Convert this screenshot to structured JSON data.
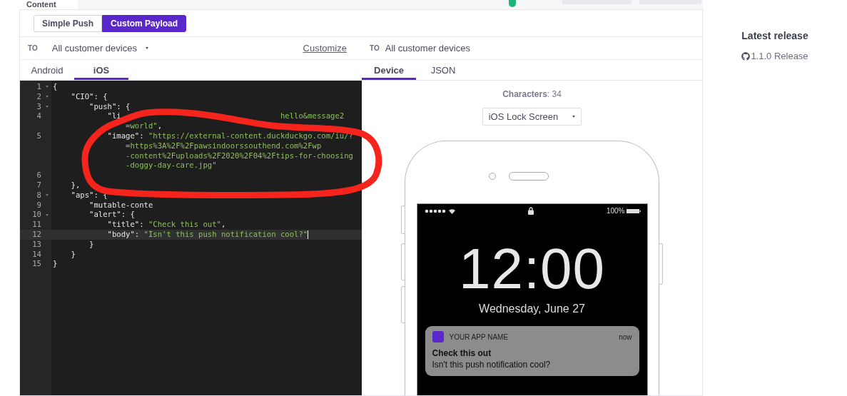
{
  "top_bar": {
    "tab": "Content"
  },
  "mode_switch": [
    {
      "label": "Simple Push",
      "selected": false
    },
    {
      "label": "Custom Payload",
      "selected": true
    }
  ],
  "left_recipients": {
    "label": "TO",
    "value": "All customer devices"
  },
  "customize_link": "Customize",
  "right_recipients": {
    "label": "TO",
    "value": "All customer devices"
  },
  "platform_tabs": [
    {
      "label": "Android",
      "selected": false
    },
    {
      "label": "iOS",
      "selected": true
    }
  ],
  "preview_tabs": [
    {
      "label": "Device",
      "selected": true
    },
    {
      "label": "JSON",
      "selected": false
    }
  ],
  "editor": {
    "rows": [
      {
        "number": "1",
        "fold": true,
        "highlighted": false,
        "parts": [
          {
            "kind": "punct",
            "text": "{"
          }
        ]
      },
      {
        "number": "2",
        "fold": true,
        "highlighted": false,
        "parts": [
          {
            "kind": "key",
            "text": "    \"CIO\": {"
          }
        ]
      },
      {
        "number": "3",
        "fold": true,
        "highlighted": false,
        "parts": [
          {
            "kind": "key",
            "text": "        \"push\": {"
          }
        ]
      },
      {
        "number": "4",
        "fold": false,
        "highlighted": false,
        "parts": [
          {
            "kind": "key",
            "text": "            \"li"
          },
          {
            "kind": "tail",
            "text": "hello&message2"
          }
        ]
      },
      {
        "fold": false,
        "highlighted": false,
        "parts": [
          {
            "kind": "string",
            "text": "                =world\""
          },
          {
            "kind": "punct",
            "text": ","
          }
        ]
      },
      {
        "number": "5",
        "fold": false,
        "highlighted": false,
        "parts": [
          {
            "kind": "key",
            "text": "            \"image\": "
          },
          {
            "kind": "string",
            "text": "\"https://external-content.duckduckgo.com/iu/?"
          }
        ]
      },
      {
        "fold": false,
        "highlighted": false,
        "parts": [
          {
            "kind": "string",
            "text": "                =https%3A%2F%2Fpawsindoorssouthend.com%2Fwp"
          }
        ]
      },
      {
        "fold": false,
        "highlighted": false,
        "parts": [
          {
            "kind": "string",
            "text": "                -content%2Fuploads%2F2020%2F04%2Ftips-for-choosing"
          }
        ]
      },
      {
        "fold": false,
        "highlighted": false,
        "parts": [
          {
            "kind": "string",
            "text": "                -doggy-day-care.jpg\""
          }
        ]
      },
      {
        "number": "6",
        "fold": false,
        "highlighted": false,
        "parts": []
      },
      {
        "number": "7",
        "fold": false,
        "highlighted": false,
        "parts": [
          {
            "kind": "punct",
            "text": "    },"
          }
        ]
      },
      {
        "number": "8",
        "fold": true,
        "highlighted": false,
        "parts": [
          {
            "kind": "key",
            "text": "    \"aps\": {"
          }
        ]
      },
      {
        "number": "9",
        "fold": false,
        "highlighted": false,
        "parts": [
          {
            "kind": "key",
            "text": "        \"mutable-conte"
          }
        ]
      },
      {
        "number": "10",
        "fold": true,
        "highlighted": false,
        "parts": [
          {
            "kind": "key",
            "text": "        \"alert\": {"
          }
        ]
      },
      {
        "number": "11",
        "fold": false,
        "highlighted": false,
        "parts": [
          {
            "kind": "key",
            "text": "            \"title\": "
          },
          {
            "kind": "string",
            "text": "\"Check this out\""
          },
          {
            "kind": "punct",
            "text": ","
          }
        ]
      },
      {
        "number": "12",
        "fold": false,
        "highlighted": true,
        "cursor": true,
        "parts": [
          {
            "kind": "key",
            "text": "            \"body\": "
          },
          {
            "kind": "string",
            "text": "\"Isn't this push notification cool?\""
          }
        ]
      },
      {
        "number": "13",
        "fold": false,
        "highlighted": false,
        "parts": [
          {
            "kind": "punct",
            "text": "        }"
          }
        ]
      },
      {
        "number": "14",
        "fold": false,
        "highlighted": false,
        "parts": [
          {
            "kind": "punct",
            "text": "    }"
          }
        ]
      },
      {
        "number": "15",
        "fold": false,
        "highlighted": false,
        "parts": [
          {
            "kind": "punct",
            "text": "}"
          }
        ]
      }
    ]
  },
  "preview": {
    "characters": "**Characters**: 34",
    "screen_select": "iOS Lock Screen",
    "phone": {
      "battery": "100%",
      "time": "12:00",
      "date": "Wednesday, June 27",
      "notification": {
        "app": "YOUR APP NAME",
        "when": "now",
        "title": "Check this out",
        "body": "Isn't this push notification cool?"
      }
    }
  },
  "sidebar": {
    "title": "Latest release",
    "release": "1.1.0 Release"
  }
}
